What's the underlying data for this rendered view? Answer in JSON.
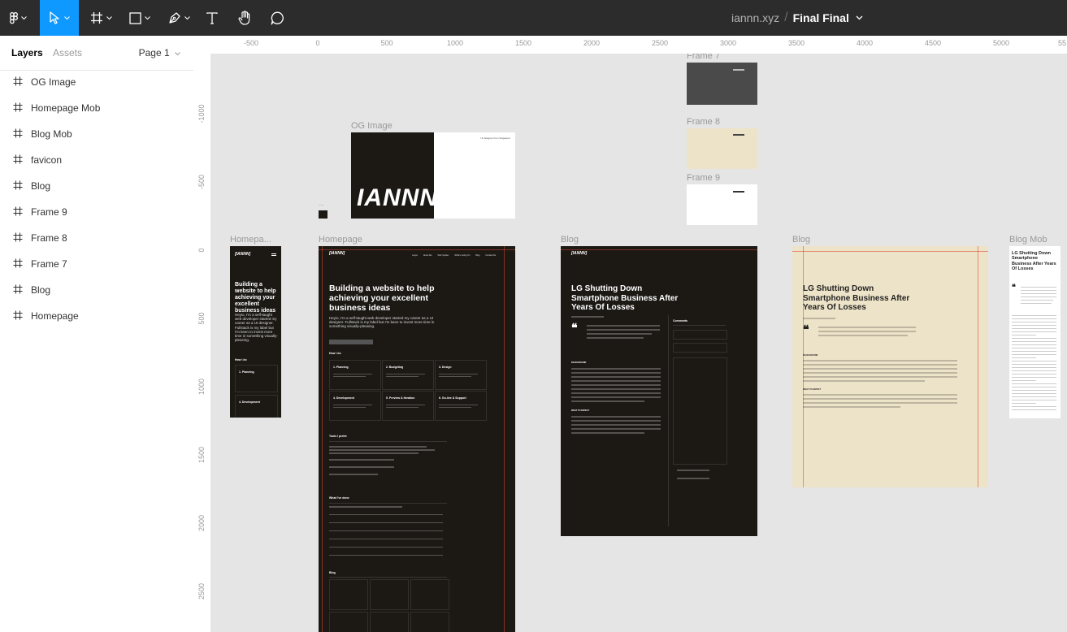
{
  "toolbar": {
    "project": "iannn.xyz",
    "separator": "/",
    "file": "Final Final",
    "tools": [
      "main-menu-icon",
      "move-tool-icon",
      "frame-tool-icon",
      "shape-tool-icon",
      "pen-tool-icon",
      "text-tool-icon",
      "hand-tool-icon",
      "comment-tool-icon"
    ]
  },
  "sidebar": {
    "tabs": {
      "layers": "Layers",
      "assets": "Assets"
    },
    "page_selector": "Page 1",
    "layers": [
      "OG Image",
      "Homepage Mob",
      "Blog Mob",
      "favicon",
      "Blog",
      "Frame 9",
      "Frame 8",
      "Frame 7",
      "Blog",
      "Homepage"
    ]
  },
  "rulers": {
    "top": [
      "-500",
      "0",
      "500",
      "1000",
      "1500",
      "2000",
      "2500",
      "3000",
      "3500",
      "4000",
      "4500",
      "5000",
      "55"
    ],
    "left": [
      "-1000",
      "-500",
      "0",
      "500",
      "1000",
      "1500",
      "2000",
      "2500"
    ]
  },
  "canvas": {
    "frame_labels": {
      "frame7": "Frame 7",
      "frame8": "Frame 8",
      "frame9": "Frame 9",
      "og_image": "OG Image",
      "homepage_mob": "Homepa...",
      "homepage": "Homepage",
      "blog_dark": "Blog",
      "blog_cream": "Blog",
      "blog_mob": "Blog Mob",
      "favicon": "..."
    },
    "og_image": {
      "logo": "IANNN",
      "tagline": "UI designer from Singapore"
    },
    "homepage": {
      "logo": "[IANNN]",
      "nav": [
        "Loops",
        "About Me",
        "Web Spotter",
        "What's Going On",
        "Blog",
        "Contact Me"
      ],
      "headline": "Building a website to help achieving your excellent business ideas",
      "intro": "Heyio, I'm a self-taught web developer started my career as a UI designer. Fullstack is my label but I'm keen to invest more time in something visually-pleasing.",
      "section_how": "How I do",
      "steps": [
        "1. Planning",
        "2. Budgeting",
        "3. Design",
        "4. Development",
        "5. Preview & Iteration",
        "6. Go-live & Support"
      ],
      "section_tools": "Tools I prefer",
      "section_done": "What I've done",
      "section_blog": "Blog"
    },
    "homepage_mob": {
      "logo": "[IANNN]",
      "headline": "Building a website to help achieving your excellent business ideas",
      "intro": "Heyio, I'm a self-taught web developer started my career as a UI designer. Fullstack is my label but I'm keen to invest more time in something visually-pleasing.",
      "section_how": "How I do",
      "step1": "1. Planning",
      "step4": "4. Development"
    },
    "blog": {
      "logo": "[IANNN]",
      "title": "LG Shutting Down Smartphone Business After Years Of Losses",
      "comments": "Comments",
      "section_background": "BACKGROUND",
      "section_impact": "WHAT TO EXPECT"
    },
    "blog_mob": {
      "title": "LG Shutting Down Smartphone Business After Years Of Losses"
    },
    "colors": {
      "accent": "#0d99ff",
      "toolbar": "#2c2c2c",
      "canvas": "#e5e5e5",
      "dark_frame": "#1c1915",
      "cream_frame": "#ede3c8",
      "guide": "#dc4628"
    }
  }
}
